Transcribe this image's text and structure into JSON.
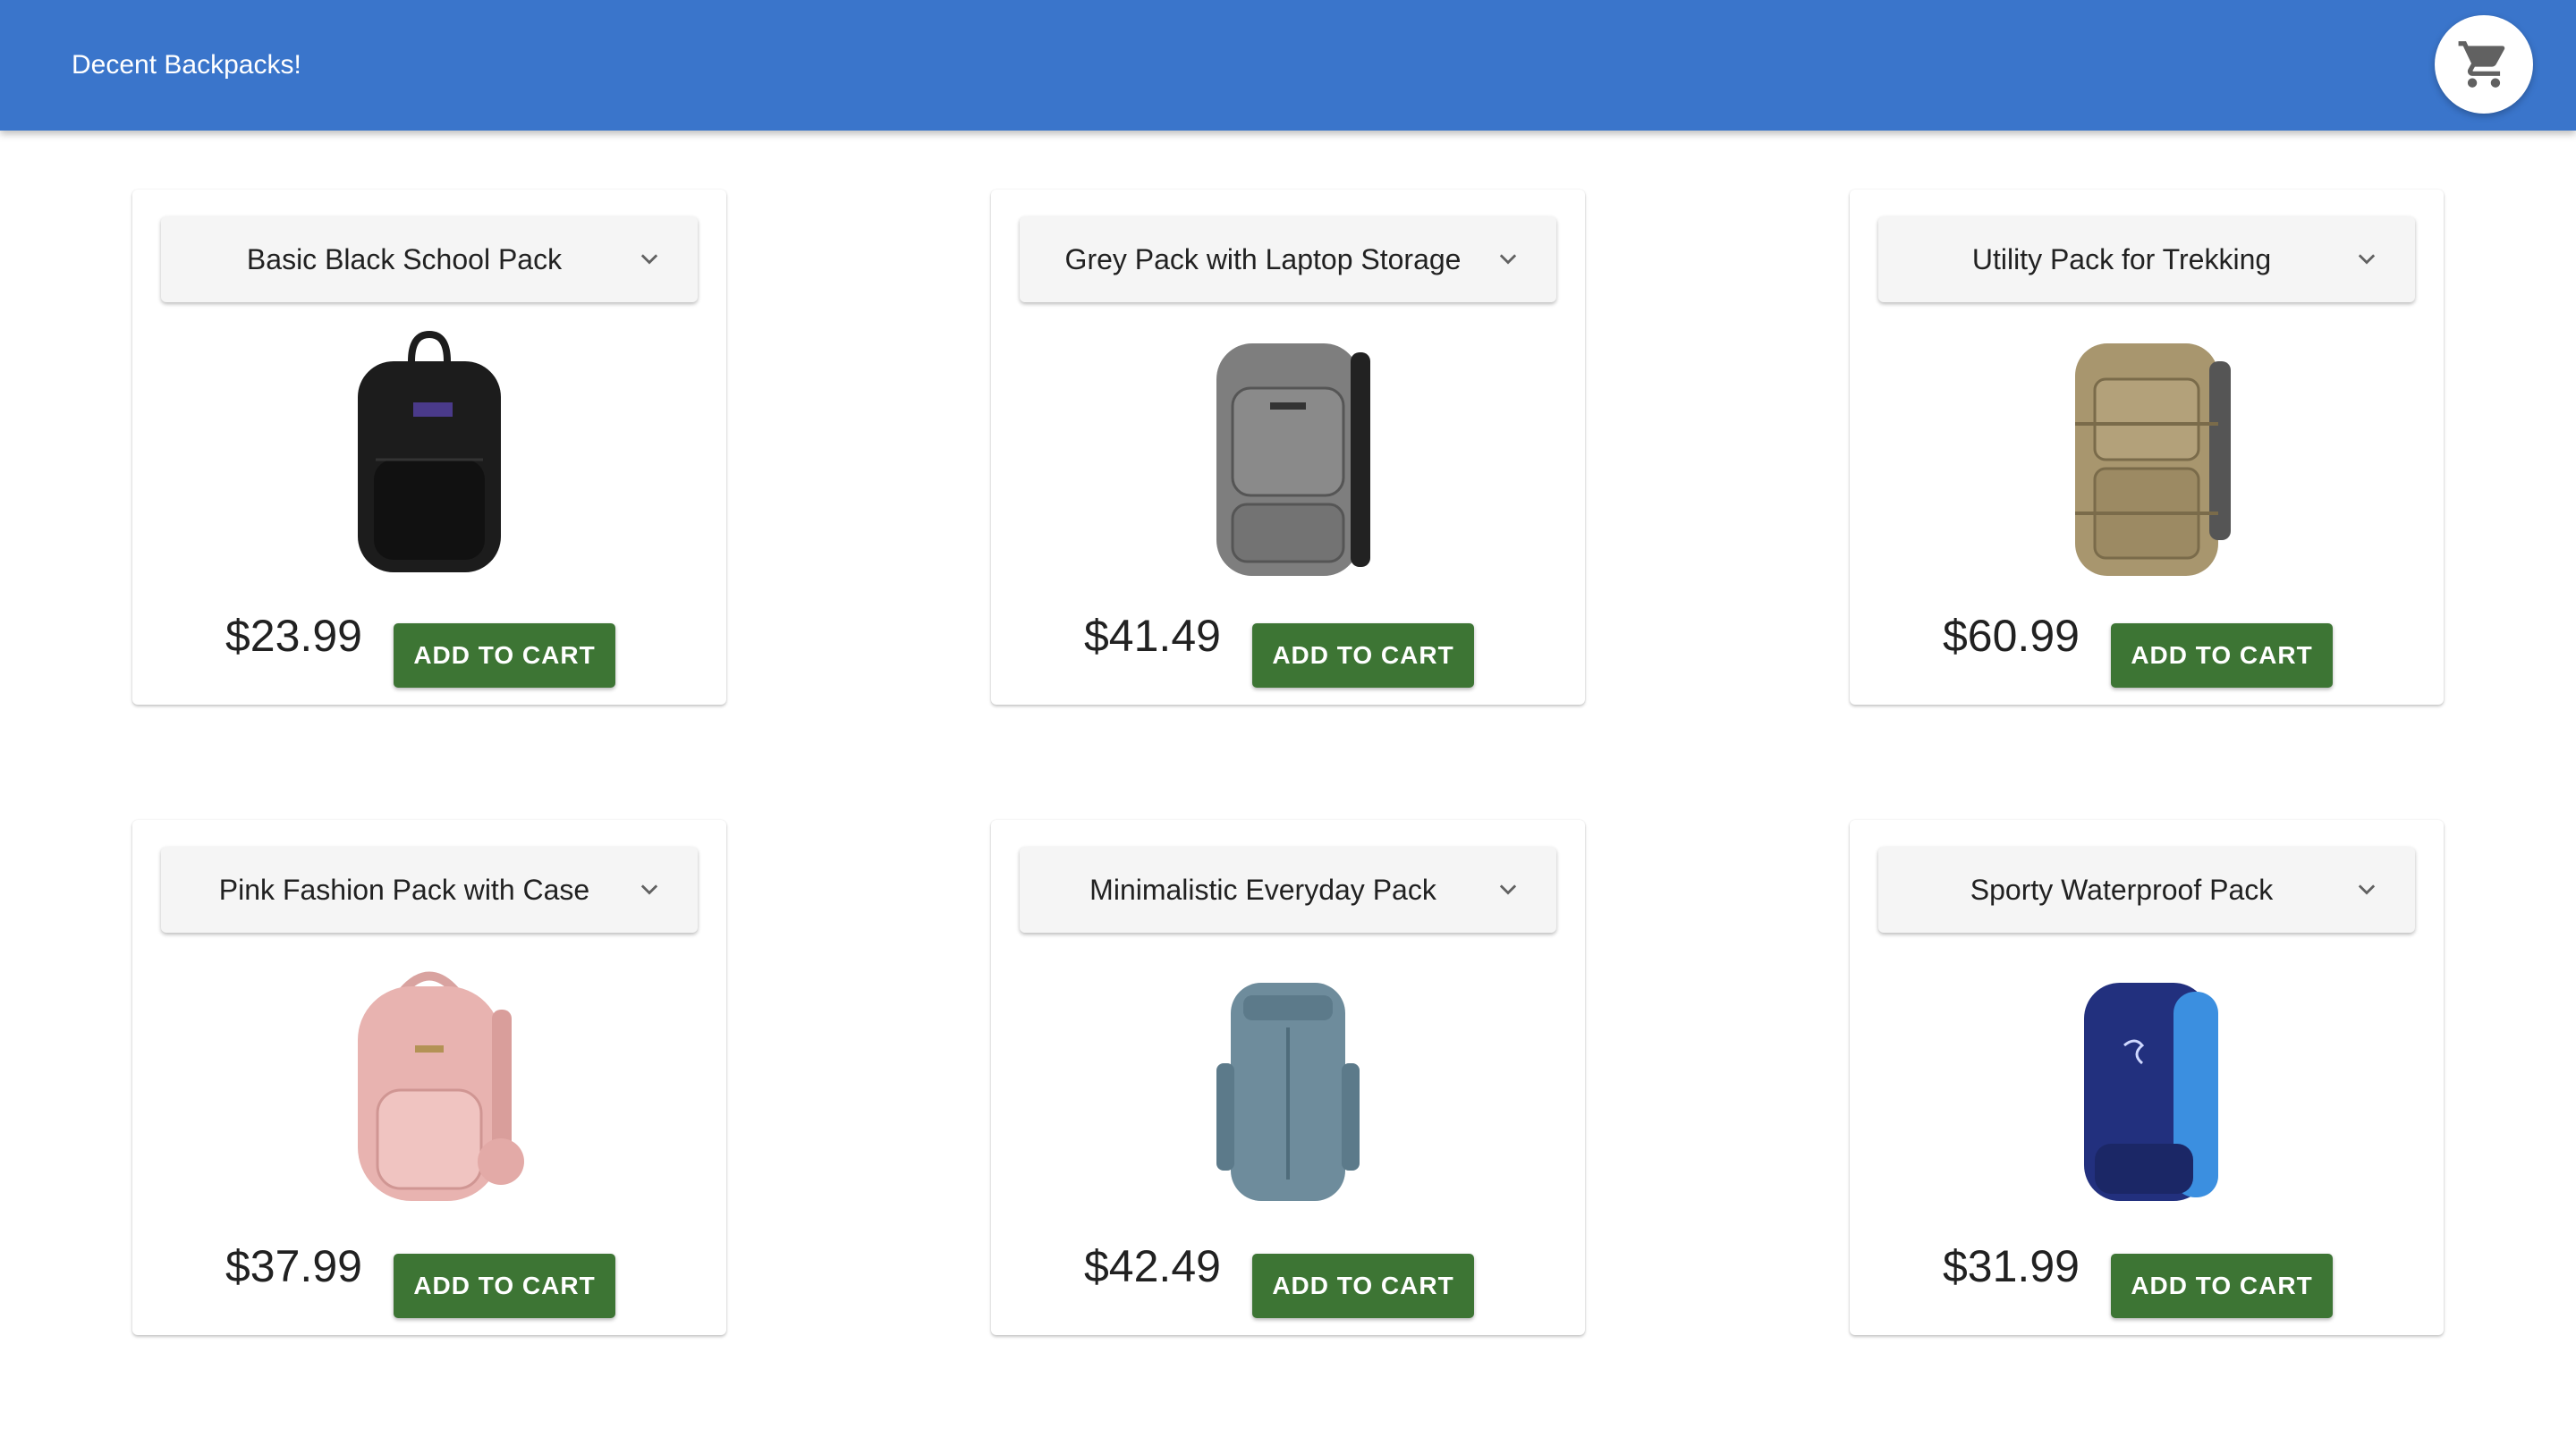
{
  "app": {
    "title": "Decent Backpacks!",
    "cart_icon": "shopping-cart-icon",
    "accent_color": "#3a75cb"
  },
  "products": [
    {
      "name": "Basic Black School Pack",
      "price": "$23.99",
      "button": "ADD TO CART",
      "image_color": "#1c1c1c"
    },
    {
      "name": "Grey Pack with Laptop Storage",
      "price": "$41.49",
      "button": "ADD TO CART",
      "image_color": "#808080"
    },
    {
      "name": "Utility Pack for Trekking",
      "price": "$60.99",
      "button": "ADD TO CART",
      "image_color": "#a8966e"
    },
    {
      "name": "Pink Fashion Pack with Case",
      "price": "$37.99",
      "button": "ADD TO CART",
      "image_color": "#e8b3b0"
    },
    {
      "name": "Minimalistic Everyday Pack",
      "price": "$42.49",
      "button": "ADD TO CART",
      "image_color": "#6e8c9c"
    },
    {
      "name": "Sporty Waterproof Pack",
      "price": "$31.99",
      "button": "ADD TO CART",
      "image_color": "#22307e"
    }
  ],
  "button_color": "#3d7534"
}
